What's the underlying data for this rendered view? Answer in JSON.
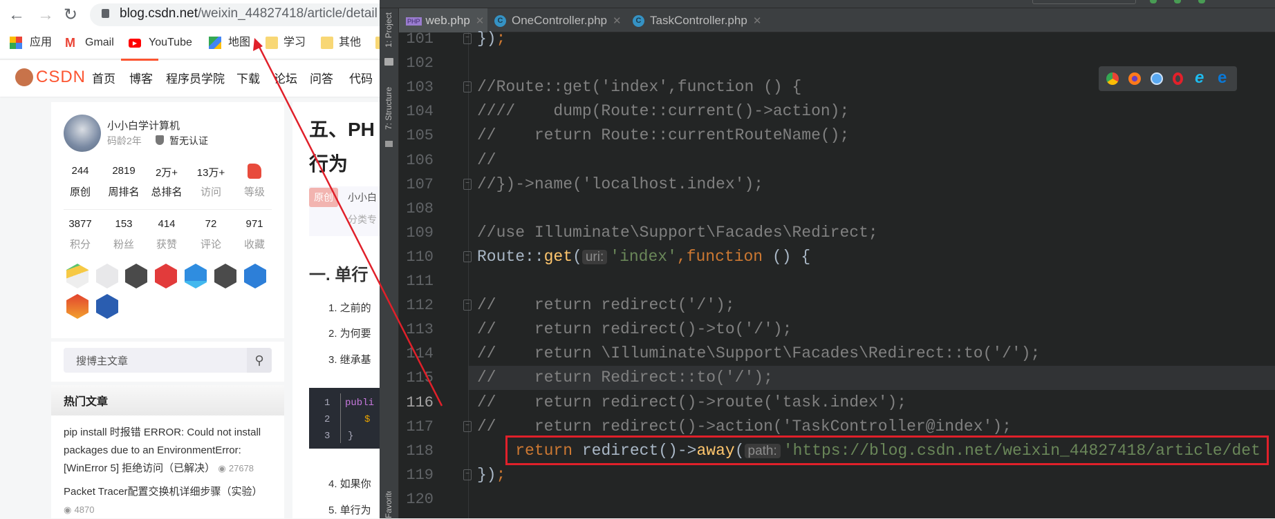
{
  "browser": {
    "url_host": "blog.csdn.net",
    "url_path": "/weixin_44827418/article/detail",
    "icons": [
      "back-arrow-icon",
      "forward-arrow-icon",
      "reload-icon",
      "lock-icon"
    ],
    "bookmarks": [
      {
        "label": "应用",
        "icon": "apps-grid-icon"
      },
      {
        "label": "Gmail",
        "icon": "gmail-icon"
      },
      {
        "label": "YouTube",
        "icon": "youtube-icon"
      },
      {
        "label": "地图",
        "icon": "maps-icon"
      },
      {
        "label": "学习",
        "icon": "folder-icon"
      },
      {
        "label": "其他",
        "icon": "folder-icon"
      }
    ]
  },
  "csdn": {
    "logo": "CSDN",
    "nav": [
      "首页",
      "博客",
      "程序员学院",
      "下载",
      "论坛",
      "问答",
      "代码"
    ],
    "profile": {
      "name": "小小白学计算机",
      "age": "码龄2年",
      "cert": "暂无认证",
      "stats1": [
        {
          "num": "244",
          "label": "原创"
        },
        {
          "num": "2819",
          "label": "周排名"
        },
        {
          "num": "2万+",
          "label": "总排名"
        },
        {
          "num": "13万+",
          "label": "访问"
        },
        {
          "num": "",
          "label": "等级"
        }
      ],
      "stats2": [
        {
          "num": "3877",
          "label": "积分"
        },
        {
          "num": "153",
          "label": "粉丝"
        },
        {
          "num": "414",
          "label": "获赞"
        },
        {
          "num": "72",
          "label": "评论"
        },
        {
          "num": "971",
          "label": "收藏"
        }
      ]
    },
    "search_placeholder": "搜博主文章",
    "hot_title": "热门文章",
    "hot": [
      {
        "title": "pip install 时报错 ERROR: Could not install packages due to an EnvironmentError: [WinError 5] 拒绝访问（已解决）",
        "views": "27678"
      },
      {
        "title": "Packet Tracer配置交换机详细步骤（实验）",
        "views": "4870"
      }
    ],
    "article": {
      "title1": "五、PH",
      "title2": "行为",
      "tag": "原创",
      "author": "小小白",
      "category": "分类专",
      "h2": "一. 单行",
      "list": [
        "1. 之前的",
        "2. 为何要",
        "3. 继承基",
        "4. 如果你",
        "5. 单行为"
      ],
      "code": [
        {
          "n": "1",
          "t": "publi"
        },
        {
          "n": "2",
          "t": "$"
        },
        {
          "n": "3",
          "t": "}"
        }
      ]
    }
  },
  "ide": {
    "side_tools": [
      "1: Project",
      "7: Structure",
      "Favorites"
    ],
    "tabs": [
      {
        "label": "web.php",
        "icon": "php-file-icon",
        "active": true
      },
      {
        "label": "OneController.php",
        "icon": "class-icon"
      },
      {
        "label": "TaskController.php",
        "icon": "class-icon"
      }
    ],
    "current_line": "116",
    "lines": [
      {
        "n": "101",
        "seg": [
          [
            "})",
            "def"
          ],
          [
            ";",
            "kw"
          ]
        ]
      },
      {
        "n": "102",
        "seg": []
      },
      {
        "n": "103",
        "seg": [
          [
            "//Route::get('index',function () {",
            "com"
          ]
        ]
      },
      {
        "n": "104",
        "seg": [
          [
            "////    dump(Route::current()->action);",
            "com"
          ]
        ]
      },
      {
        "n": "105",
        "seg": [
          [
            "//    return Route::currentRouteName();",
            "com"
          ]
        ]
      },
      {
        "n": "106",
        "seg": [
          [
            "//",
            "com"
          ]
        ]
      },
      {
        "n": "107",
        "seg": [
          [
            "//})->name('localhost.index');",
            "com"
          ]
        ]
      },
      {
        "n": "108",
        "seg": []
      },
      {
        "n": "109",
        "seg": [
          [
            "//use Illuminate\\Support\\Facades\\Redirect;",
            "com"
          ]
        ]
      },
      {
        "n": "110",
        "seg": [
          [
            "Route::",
            "def"
          ],
          [
            "get",
            "fn"
          ],
          [
            "(",
            "def"
          ],
          [
            "uri:",
            "hint"
          ],
          [
            "'index'",
            "str"
          ],
          [
            ",function",
            "kw"
          ],
          [
            " () {",
            "def"
          ]
        ]
      },
      {
        "n": "111",
        "seg": []
      },
      {
        "n": "112",
        "seg": [
          [
            "//    return redirect('/');",
            "com"
          ]
        ]
      },
      {
        "n": "113",
        "seg": [
          [
            "//    return redirect()->to('/');",
            "com"
          ]
        ]
      },
      {
        "n": "114",
        "seg": [
          [
            "//    return \\Illuminate\\Support\\Facades\\Redirect::to('/');",
            "com"
          ]
        ]
      },
      {
        "n": "115",
        "seg": [
          [
            "//    return Redirect::to('/');",
            "com"
          ]
        ]
      },
      {
        "n": "116",
        "seg": [
          [
            "//    return redirect()->route('task.index');",
            "com"
          ]
        ]
      },
      {
        "n": "117",
        "seg": [
          [
            "//    return redirect()->action('TaskController@index');",
            "com"
          ]
        ]
      },
      {
        "n": "118",
        "seg": [
          [
            "    ",
            "def"
          ],
          [
            "return",
            "kw"
          ],
          [
            " redirect()->",
            "def"
          ],
          [
            "away",
            "fn"
          ],
          [
            "(",
            "def"
          ],
          [
            "path:",
            "hint"
          ],
          [
            "'https://blog.csdn.net/weixin_44827418/article/det",
            "str"
          ]
        ]
      },
      {
        "n": "119",
        "seg": [
          [
            "})",
            "def"
          ],
          [
            ";",
            "kw"
          ]
        ]
      },
      {
        "n": "120",
        "seg": []
      }
    ],
    "browser_popup": [
      "chrome-icon",
      "firefox-icon",
      "safari-icon",
      "opera-icon",
      "ie-icon",
      "edge-icon"
    ]
  },
  "colors": {
    "annotation": "#e0202a",
    "csdn_red": "#fc5531",
    "comment": "#808080",
    "keyword": "#cc7832",
    "string": "#6a8759",
    "function": "#ffc66d"
  }
}
